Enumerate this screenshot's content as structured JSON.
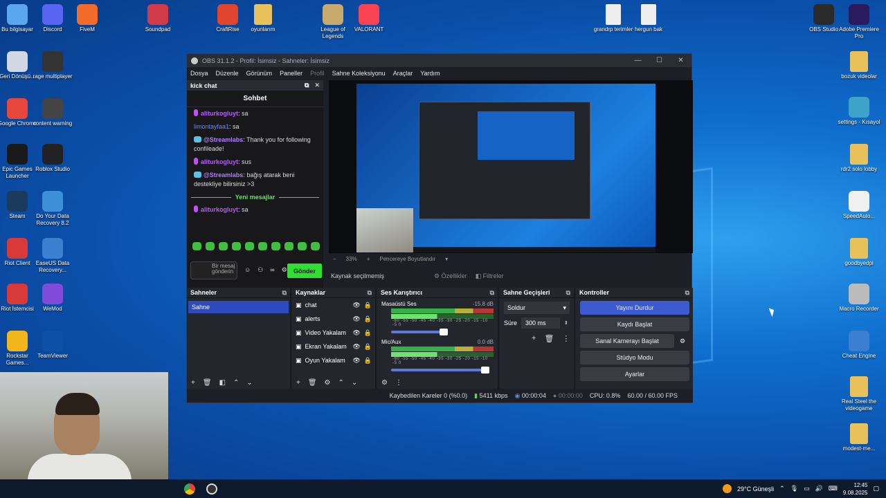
{
  "desktop": {
    "left_icons": [
      {
        "label": "Bu bilgisayar",
        "icon": "computer-icon",
        "color": "#5aa7f0"
      },
      {
        "label": "Geri Dönüşü...",
        "icon": "recycle-bin-icon",
        "color": "#cfd8e3"
      },
      {
        "label": "Google Chrome",
        "icon": "chrome-icon",
        "color": "#e9463b"
      },
      {
        "label": "Epic Games Launcher",
        "icon": "epic-icon",
        "color": "#1a1a1a"
      },
      {
        "label": "Steam",
        "icon": "steam-icon",
        "color": "#1a3a5e"
      },
      {
        "label": "Riot Client",
        "icon": "riot-icon",
        "color": "#d83a3a"
      },
      {
        "label": "Riot İstemcisi",
        "icon": "riot-icon",
        "color": "#d83a3a"
      },
      {
        "label": "Rockstar Games...",
        "icon": "rockstar-icon",
        "color": "#f2b51c"
      }
    ],
    "col2_icons": [
      {
        "label": "Discord",
        "icon": "discord-icon",
        "color": "#5865f2"
      },
      {
        "label": "rage multiplayer",
        "icon": "rage-icon",
        "color": "#333"
      },
      {
        "label": "content warning",
        "icon": "file-icon",
        "color": "#444"
      },
      {
        "label": "Roblox Studio",
        "icon": "roblox-icon",
        "color": "#222"
      },
      {
        "label": "Do Your Data Recovery 8.2",
        "icon": "recovery-icon",
        "color": "#3c8fd9"
      },
      {
        "label": "EaseUS Data Recovery...",
        "icon": "easeus-icon",
        "color": "#3a7fd0"
      },
      {
        "label": "WeMod",
        "icon": "wemod-icon",
        "color": "#7f4bd8"
      },
      {
        "label": "TeamViewer",
        "icon": "teamviewer-icon",
        "color": "#0e4fa8"
      }
    ],
    "top_icons": [
      {
        "label": "FiveM",
        "icon": "fivem-icon",
        "color": "#f26b2a"
      },
      {
        "label": "Soundpad",
        "icon": "soundpad-icon",
        "color": "#d23a4a"
      },
      {
        "label": "CraftRise",
        "icon": "craftrise-icon",
        "color": "#e0462e"
      },
      {
        "label": "oyunlarım",
        "icon": "folder-icon",
        "color": "#e9c15a"
      },
      {
        "label": "League of Legends",
        "icon": "lol-icon",
        "color": "#c8aa6e"
      },
      {
        "label": "VALORANT",
        "icon": "valorant-icon",
        "color": "#fa4454"
      },
      {
        "label": "grandrp terimler",
        "icon": "file-icon",
        "color": "#eee"
      },
      {
        "label": "hergun bak",
        "icon": "file-icon",
        "color": "#eee"
      }
    ],
    "right_icons": [
      {
        "label": "OBS Studio",
        "icon": "obs-icon",
        "color": "#2a2a2a"
      },
      {
        "label": "Adobe Premiere Pro",
        "icon": "premiere-icon",
        "color": "#2a1a5e"
      },
      {
        "label": "bozuk videolar",
        "icon": "folder-icon",
        "color": "#e9c15a"
      },
      {
        "label": "settings - Kısayol",
        "icon": "settings-shortcut-icon",
        "color": "#3fa3c9"
      },
      {
        "label": "rdr2 solo lobby",
        "icon": "folder-icon",
        "color": "#e9c15a"
      },
      {
        "label": "SpeedAuto...",
        "icon": "mouse-icon",
        "color": "#f0f0f0"
      },
      {
        "label": "goodbyedpi",
        "icon": "folder-icon",
        "color": "#e9c15a"
      },
      {
        "label": "Macro Recorder",
        "icon": "macro-icon",
        "color": "#bbb"
      },
      {
        "label": "Cheat Engine",
        "icon": "cheat-engine-icon",
        "color": "#3a7fd0"
      },
      {
        "label": "Real Steel the videogame",
        "icon": "folder-icon",
        "color": "#e9c15a"
      },
      {
        "label": "modest-me...",
        "icon": "folder-icon",
        "color": "#e9c15a"
      }
    ]
  },
  "obs": {
    "title": "OBS 31.1.2 - Profil: İsimsiz - Sahneler: İsimsiz",
    "menu": [
      "Dosya",
      "Düzenle",
      "Görünüm",
      "Paneller",
      "Profil",
      "Sahne Koleksiyonu",
      "Araçlar",
      "Yardım"
    ],
    "chat_dock": {
      "header": "kick chat",
      "title": "Sohbet",
      "messages": [
        {
          "user": "aliturkogluyt",
          "text": ": sa",
          "kind": "mic"
        },
        {
          "user": "limontayfaa1",
          "text": ": sa",
          "kind": "plain"
        },
        {
          "user": "@Streamlabs",
          "text": ": Thank you for following confileade!",
          "kind": "bot"
        },
        {
          "user": "aliturkogluyt",
          "text": ": sus",
          "kind": "mic"
        },
        {
          "user": "@Streamlabs",
          "text": ": bağış atarak beni destekliye bilirsiniz >3",
          "kind": "bot"
        }
      ],
      "new_messages": "Yeni mesajlar",
      "last_message": {
        "user": "aliturkogluyt",
        "text": ": sa"
      },
      "input_placeholder": "Bir mesaj gönderin",
      "send": "Gönder"
    },
    "preview": {
      "zoom": "33%",
      "fit": "Pencereye Boyutlandır"
    },
    "source_bar": {
      "label": "Kaynak seçilmemiş",
      "properties": "Özellikler",
      "filters": "Filtreler"
    },
    "scenes": {
      "header": "Sahneler",
      "items": [
        "Sahne"
      ]
    },
    "sources": {
      "header": "Kaynaklar",
      "items": [
        {
          "name": "chat",
          "icon": "browser-icon"
        },
        {
          "name": "alerts",
          "icon": "browser-icon"
        },
        {
          "name": "Video Yakalam",
          "icon": "video-capture-icon"
        },
        {
          "name": "Ekran Yakalam",
          "icon": "display-capture-icon"
        },
        {
          "name": "Oyun Yakalam",
          "icon": "game-capture-icon"
        }
      ]
    },
    "mixer": {
      "header": "Ses Karıştırıcı",
      "channels": [
        {
          "name": "Masaüstü Ses",
          "db": "-15.8 dB"
        },
        {
          "name": "Mic/Aux",
          "db": "0.0 dB"
        }
      ],
      "scale": "-60 -55 -50 -45 -40 -35 -30 -25 -20 -15 -10 -5 0"
    },
    "transitions": {
      "header": "Sahne Geçişleri",
      "type": "Soldur",
      "duration_label": "Süre",
      "duration": "300 ms"
    },
    "controls": {
      "header": "Kontroller",
      "buttons": [
        "Yayını Durdur",
        "Kaydı Başlat",
        "Sanal Kamerayı Başlat",
        "Stüdyo Modu",
        "Ayarlar"
      ]
    },
    "status": {
      "dropped": "Kaybedilen Kareler 0 (%0.0)",
      "bitrate": "5411 kbps",
      "stream_time": "00:00:04",
      "rec_time": "00:00:00",
      "cpu": "CPU: 0.8%",
      "fps": "60.00 / 60.00 FPS"
    }
  },
  "taskbar": {
    "weather": "29°C  Güneşli",
    "time": "12:45",
    "date": "9.08.2025"
  }
}
